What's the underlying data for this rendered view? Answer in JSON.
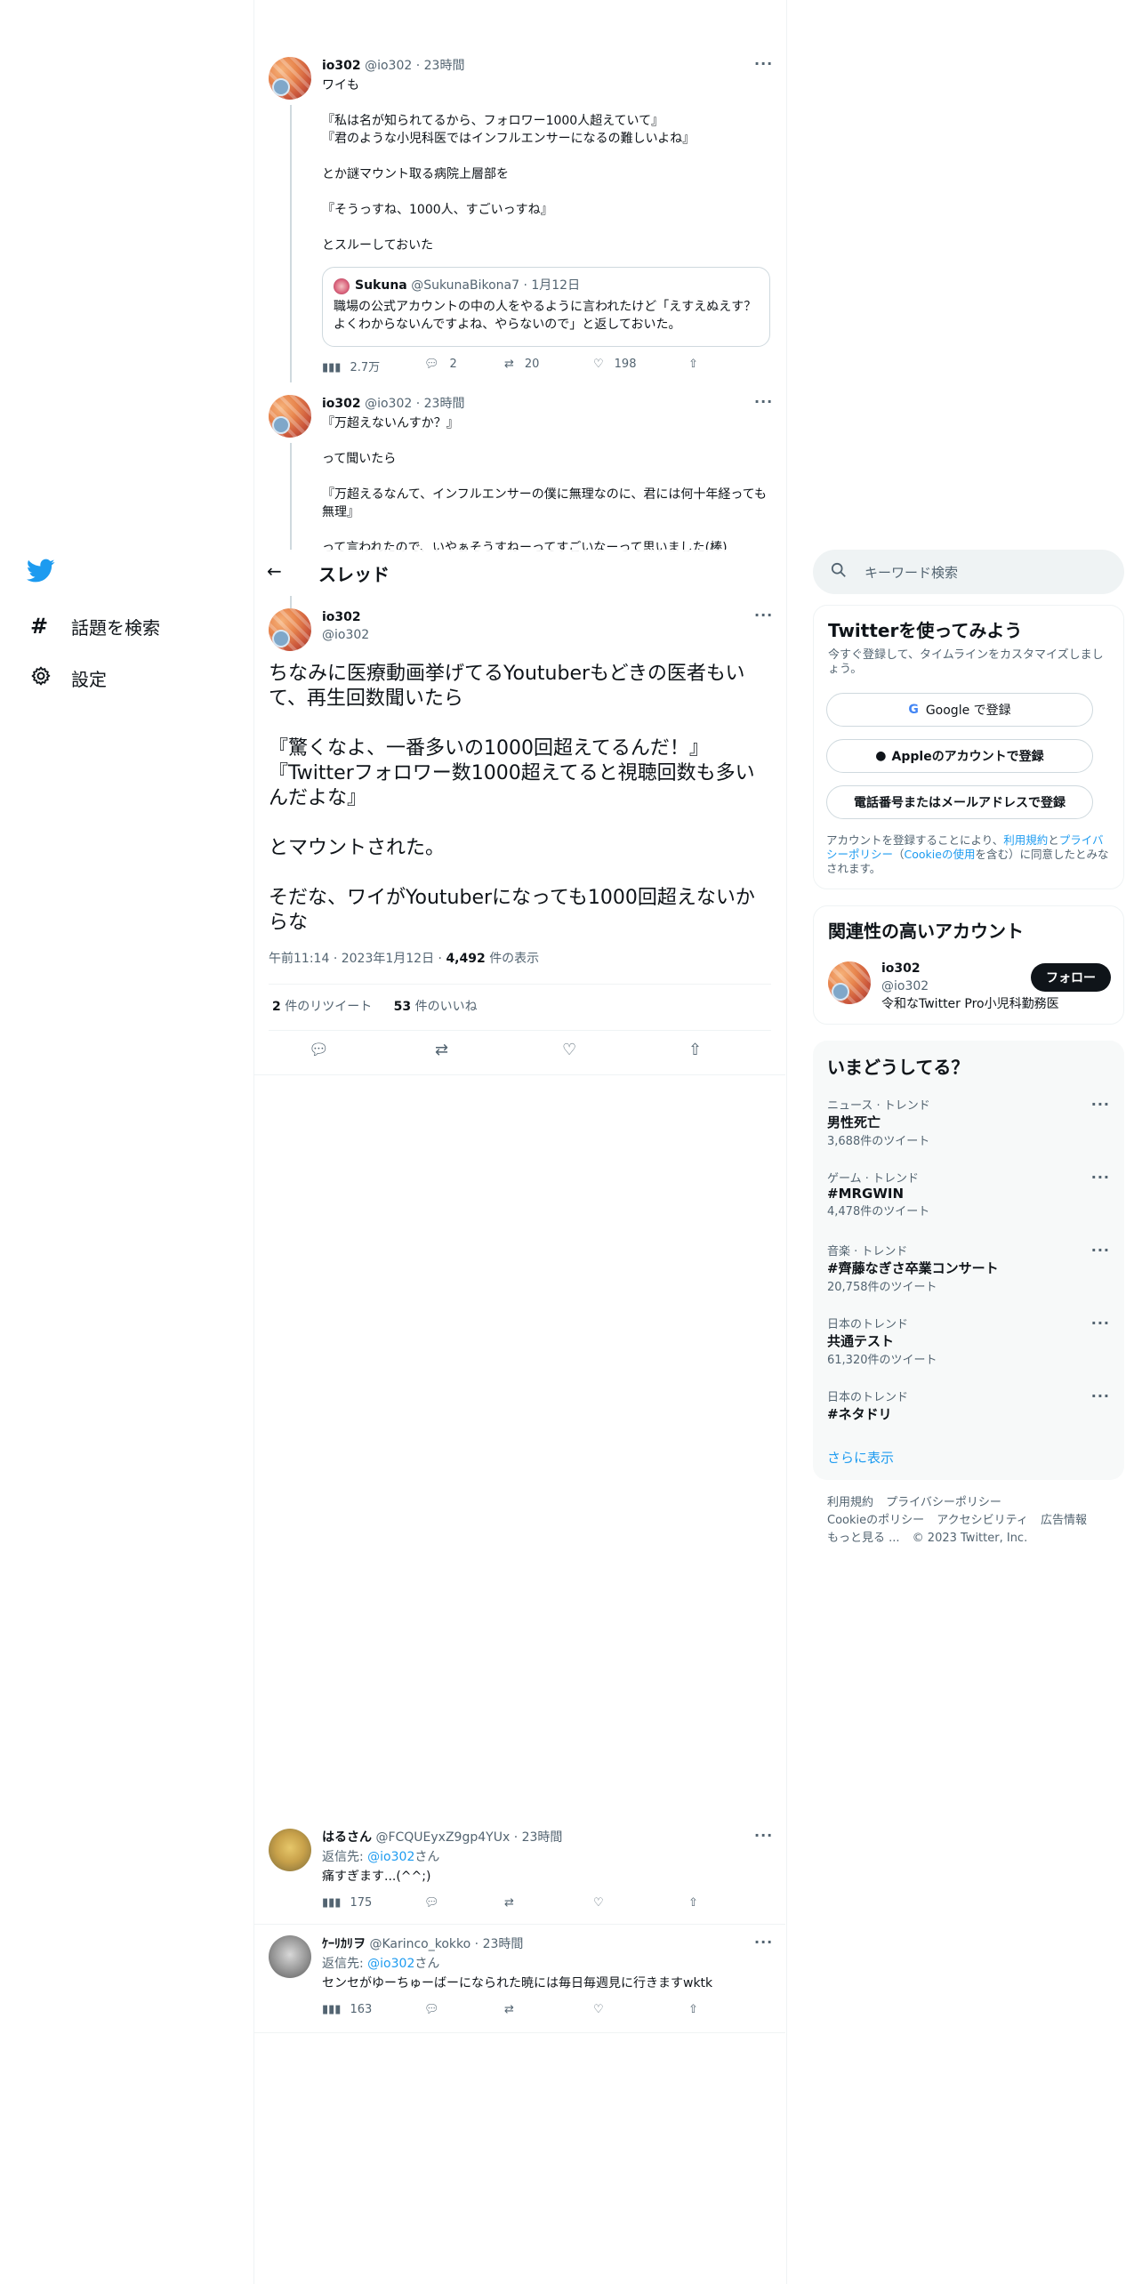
{
  "nav": {
    "explore_label": "話題を検索",
    "settings_label": "設定"
  },
  "header": {
    "title": "スレッド",
    "search_placeholder": "キーワード検索"
  },
  "thread_tweets": [
    {
      "name": "io302",
      "handle": "@io302",
      "time": "23時間",
      "text": "ワイも\n\n『私は名が知られてるから、フォロワー1000人超えていて』\n『君のような小児科医ではインフルエンサーになるの難しいよね』\n\nとか謎マウント取る病院上層部を\n\n『そうっすね、1000人、すごいっすね』\n\nとスルーしておいた",
      "quote": {
        "name": "Sukuna",
        "handle": "@SukunaBikona7",
        "date": "1月12日",
        "text": "職場の公式アカウントの中の人をやるように言われたけど「えすえぬえす？よくわからないんですよね、やらないので」と返しておいた。"
      },
      "views": "2.7万",
      "replies": "2",
      "retweets": "20",
      "likes": "198"
    },
    {
      "name": "io302",
      "handle": "@io302",
      "time": "23時間",
      "text": "『万超えないんすか？』\n\nって聞いたら\n\n『万超えるなんて、インフルエンサーの僕に無理なのに、君には何十年経っても無理』\n\nって言われたので、いやぁそうすねーってすごいなーって思いました(棒)"
    }
  ],
  "main_tweet": {
    "name": "io302",
    "handle": "@io302",
    "text": "ちなみに医療動画挙げてるYoutuberもどきの医者もいて、再生回数聞いたら\n\n『驚くなよ、一番多いの1000回超えてるんだ！』\n『Twitterフォロワー数1000超えてると視聴回数も多いんだよな』\n\nとマウントされた。\n\nそだな、ワイがYoutuberになっても1000回超えないからな",
    "time": "午前11:14",
    "date": "2023年1月12日",
    "views": "4,492",
    "views_label": "件の表示",
    "retweets": "2",
    "retweets_label": "件のリツイート",
    "likes": "53",
    "likes_label": "件のいいね"
  },
  "replies": [
    {
      "name": "はるさん",
      "handle": "@FCQUEyxZ9gp4YUx",
      "time": "23時間",
      "reply_to_prefix": "返信先: ",
      "reply_to": "@io302",
      "reply_to_suffix": "さん",
      "text": "痛すぎます...(^^;)",
      "views": "175"
    },
    {
      "name": "ｹｰﾘｶﾘヲ",
      "handle": "@Karinco_kokko",
      "time": "23時間",
      "reply_to_prefix": "返信先: ",
      "reply_to": "@io302",
      "reply_to_suffix": "さん",
      "text": "センセがゆーちゅーばーになられた暁には毎日毎週見に行きますwktk",
      "views": "163"
    }
  ],
  "signup": {
    "title": "Twitterを使ってみよう",
    "subtitle": "今すぐ登録して、タイムラインをカスタマイズしましょう。",
    "google": "Google で登録",
    "apple": "Appleのアカウントで登録",
    "phone": "電話番号またはメールアドレスで登録",
    "legal_1": "アカウントを登録することにより、",
    "terms": "利用規約",
    "legal_2": "と",
    "privacy": "プライバシーポリシー",
    "legal_3": "（",
    "cookie": "Cookieの使用",
    "legal_4": "を含む）に同意したとみなされます。"
  },
  "related": {
    "title": "関連性の高いアカウント",
    "name": "io302",
    "handle": "@io302",
    "bio": "令和なTwitter Pro小児科勤務医",
    "follow": "フォロー"
  },
  "trends": {
    "title": "いまどうしてる？",
    "items": [
      {
        "category": "ニュース · トレンド",
        "name": "男性死亡",
        "count": "3,688件のツイート"
      },
      {
        "category": "ゲーム · トレンド",
        "name": "#MRGWIN",
        "count": "4,478件のツイート"
      },
      {
        "category": "音楽 · トレンド",
        "name": "#齊藤なぎさ卒業コンサート",
        "count": "20,758件のツイート"
      },
      {
        "category": "日本のトレンド",
        "name": "共通テスト",
        "count": "61,320件のツイート"
      },
      {
        "category": "日本のトレンド",
        "name": "#ネタドリ",
        "count": ""
      }
    ],
    "more": "さらに表示"
  },
  "footer": {
    "terms": "利用規約",
    "privacy": "プライバシーポリシー",
    "cookie": "Cookieのポリシー",
    "accessibility": "アクセシビリティ",
    "ads": "広告情報",
    "more": "もっと見る ...",
    "copyright": "© 2023 Twitter, Inc."
  },
  "colors": {
    "accent": "#1d9bf0",
    "text": "#0f1419",
    "muted": "#536471",
    "border": "#eff3f4"
  }
}
